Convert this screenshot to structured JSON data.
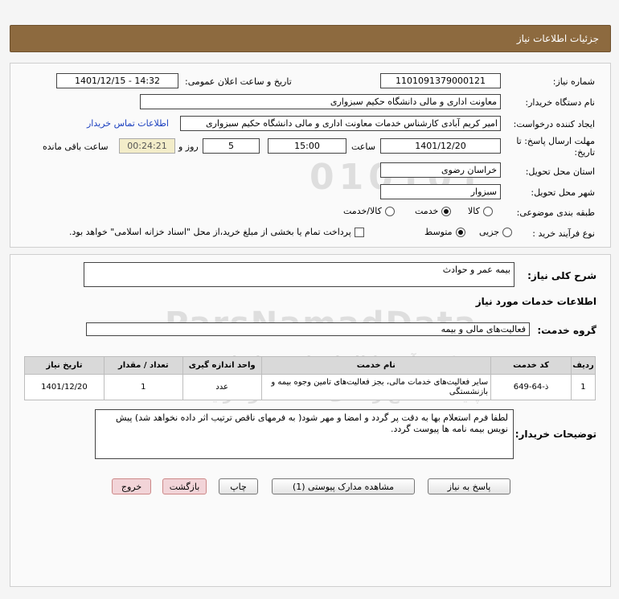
{
  "header": {
    "title": "جزئیات اطلاعات نیاز"
  },
  "form": {
    "need_number_label": "شماره نیاز:",
    "need_number": "1101091379000121",
    "announce_label": "تاریخ و ساعت اعلان عمومی:",
    "announce_value": "1401/12/15 - 14:32",
    "buyer_org_label": "نام دستگاه خریدار:",
    "buyer_org": "معاونت اداری و مالی دانشگاه حکیم سبزواری",
    "creator_label": "ایجاد کننده درخواست:",
    "creator": "امیر کریم آبادی کارشناس خدمات معاونت اداری و مالی دانشگاه حکیم سبزواری",
    "contact_link": "اطلاعات تماس خریدار",
    "deadline_label_1": "مهلت ارسال پاسخ: تا",
    "deadline_label_2": "تاریخ:",
    "deadline_date": "1401/12/20",
    "time_label": "ساعت",
    "deadline_time": "15:00",
    "days_value": "5",
    "days_label": "روز و",
    "remaining_timer": "00:24:21",
    "remaining_label": "ساعت باقی مانده",
    "province_label": "استان محل تحویل:",
    "province": "خراسان رضوی",
    "city_label": "شهر محل تحویل:",
    "city": "سبزوار",
    "category_label": "طبقه بندی موضوعی:",
    "category_options": [
      "کالا",
      "خدمت",
      "کالا/خدمت"
    ],
    "category_selected": 1,
    "purchase_type_label": "نوع فرآیند خرید :",
    "purchase_options": [
      "جزیی",
      "متوسط"
    ],
    "purchase_selected": 1,
    "payment_note": "پرداخت تمام یا بخشی از مبلغ خرید،از محل \"اسناد خزانه اسلامی\" خواهد بود."
  },
  "details": {
    "summary_label": "شرح کلی نیاز:",
    "summary": "بیمه عمر و حوادث",
    "services_heading": "اطلاعات خدمات مورد نیاز",
    "service_group_label": "گروه خدمت:",
    "service_group": "فعالیت‌های مالی و بیمه",
    "table": {
      "headers": [
        "ردیف",
        "کد خدمت",
        "نام خدمت",
        "واحد اندازه گیری",
        "تعداد / مقدار",
        "تاریخ نیاز"
      ],
      "rows": [
        [
          "1",
          "ذ-64-649",
          "سایر فعالیت‌های خدمات مالی، بجز فعالیت‌های تامین وجوه بیمه و بازنشستگی",
          "عدد",
          "1",
          "1401/12/20"
        ]
      ]
    },
    "buyer_notes_label": "توضیحات خریدار:",
    "buyer_notes": "لطفا فرم استعلام بها به دقت پر گردد و امضا و مهر شود( به فرمهای ناقص ترتیب اثر داده نخواهد شد) پیش نویس بیمه نامه ها پیوست گردد."
  },
  "buttons": {
    "reply": "پاسخ به نیاز",
    "attachments": "مشاهده مدارک پیوستی (1)",
    "print": "چاپ",
    "back": "بازگشت",
    "exit": "خروج"
  },
  "watermark": {
    "brand": "ParsNamadData",
    "line1": "مرکز فرآوری اطلاعات پارس نماد داده",
    "line2": "پایگاه اطلاع رسانی مناقصه و مزایده",
    "phone": "۰۲۱-۸۸۳۴۹۶۷۰",
    "digits": "010101"
  }
}
